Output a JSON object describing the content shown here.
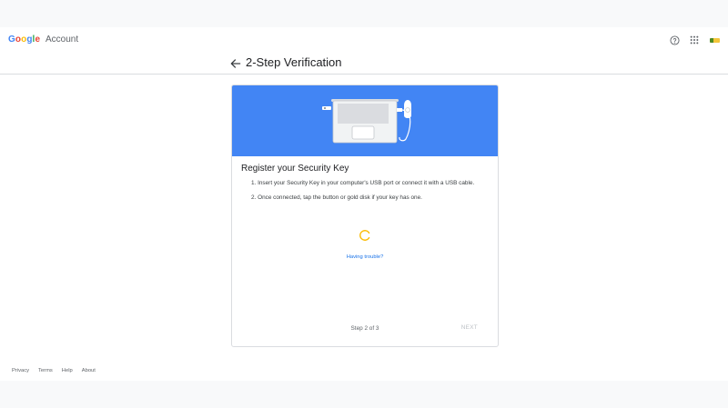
{
  "brand": {
    "google_letters": [
      "G",
      "o",
      "o",
      "g",
      "l",
      "e"
    ],
    "google_colors": [
      "#4285f4",
      "#ea4335",
      "#fbbc05",
      "#4285f4",
      "#34a853",
      "#ea4335"
    ],
    "account_label": "Account"
  },
  "topbar": {
    "icons": [
      "help-icon",
      "apps-grid-icon",
      "avatar"
    ]
  },
  "header": {
    "title": "2-Step Verification"
  },
  "card": {
    "title": "Register your Security Key",
    "steps": [
      "1. Insert your Security Key in your computer's USB port or connect it with a USB cable.",
      "2. Once connected, tap the button or gold disk if your key has one."
    ],
    "trouble_link": "Having trouble?",
    "step_indicator": "Step 2 of 3",
    "next_label": "NEXT",
    "colors": {
      "hero": "#4285f4",
      "spinner": "#fbbc05",
      "link": "#1a73e8",
      "disabled": "#bdc1c6"
    }
  },
  "footer": {
    "links": [
      "Privacy",
      "Terms",
      "Help",
      "About"
    ]
  }
}
